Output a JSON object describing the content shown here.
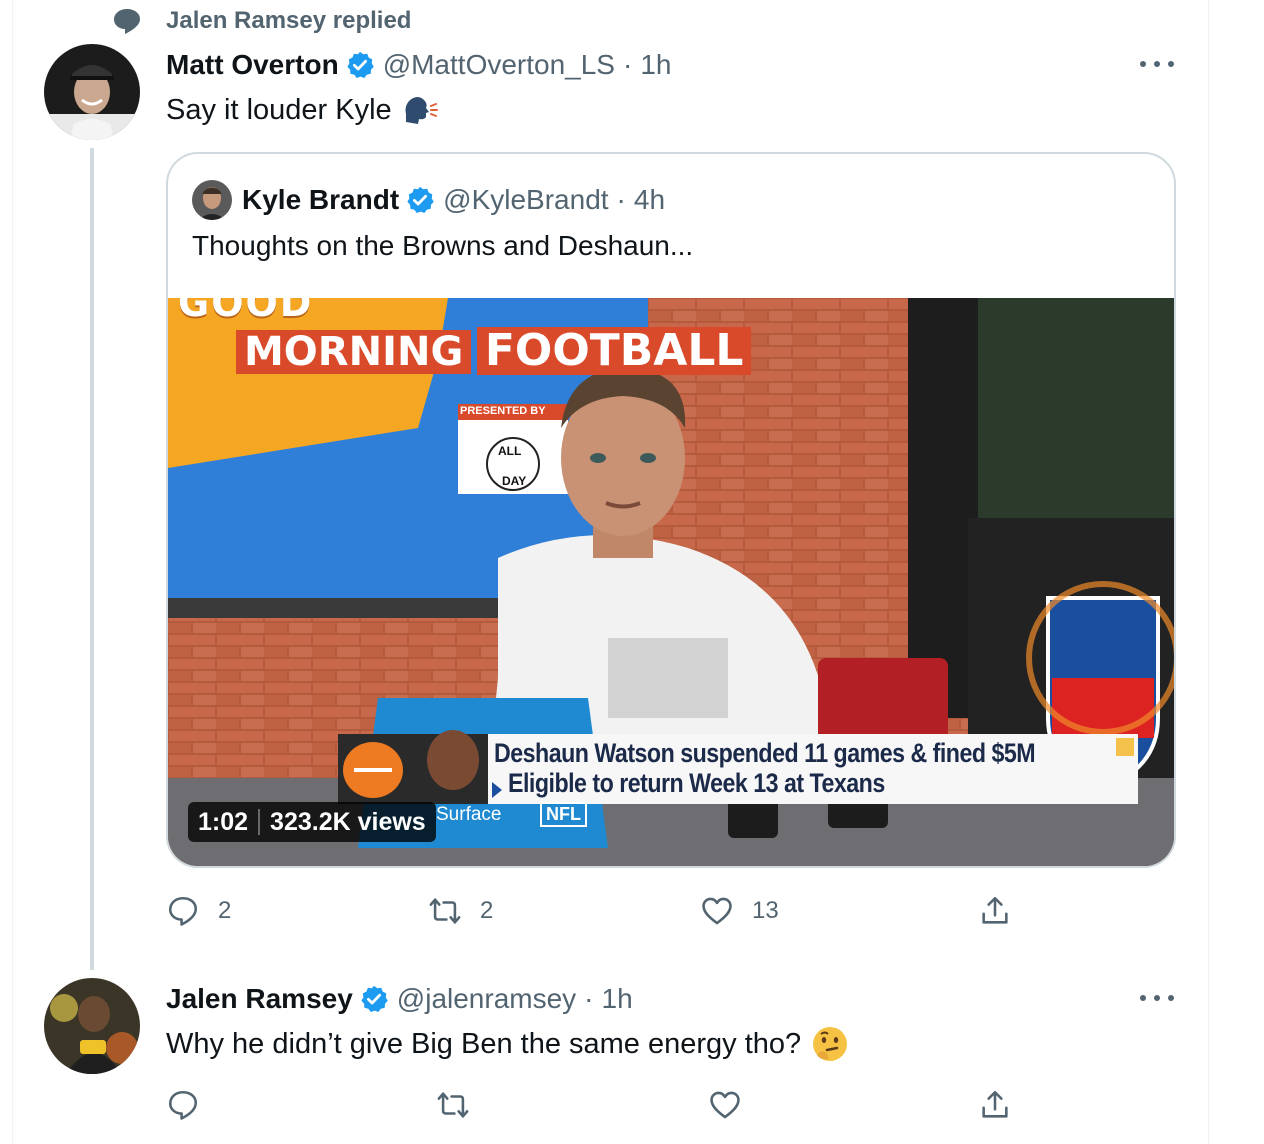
{
  "social_context": {
    "text": "Jalen Ramsey replied",
    "icon": "speech-bubble-icon"
  },
  "reply_tweet": {
    "author": {
      "name": "Matt Overton",
      "handle": "@MattOverton_LS",
      "verified": true
    },
    "separator": "·",
    "time": "1h",
    "text": "Say it louder Kyle",
    "emoji": "speaking-head-emoji",
    "quoted": {
      "author": {
        "name": "Kyle Brandt",
        "handle": "@KyleBrandt",
        "verified": true
      },
      "separator": "·",
      "time": "4h",
      "text": "Thoughts on the Browns and Deshaun...",
      "video": {
        "duration": "1:02",
        "views": "323.2K views",
        "show_logo": [
          "GOOD",
          "MORNING",
          "FOOTBALL"
        ],
        "presented_by": "PRESENTED BY",
        "all_day": [
          "ALL",
          "DAY"
        ],
        "chyron_line1": "Deshaun Watson suspended 11 games & fined $5M",
        "chyron_line2": "Eligible to return Week 13 at Texans",
        "tablet_brand": "Surface",
        "nfl_badge": "NFL"
      }
    },
    "actions": {
      "reply_count": "2",
      "retweet_count": "2",
      "like_count": "13"
    }
  },
  "second_tweet": {
    "author": {
      "name": "Jalen Ramsey",
      "handle": "@jalenramsey",
      "verified": true
    },
    "separator": "·",
    "time": "1h",
    "text": "Why he didn’t give Big Ben the same energy tho?",
    "emoji": "thinking-face-emoji"
  },
  "colors": {
    "verified": "#1d9bf0",
    "secondary_text": "#536471",
    "border": "#cfd9de"
  }
}
